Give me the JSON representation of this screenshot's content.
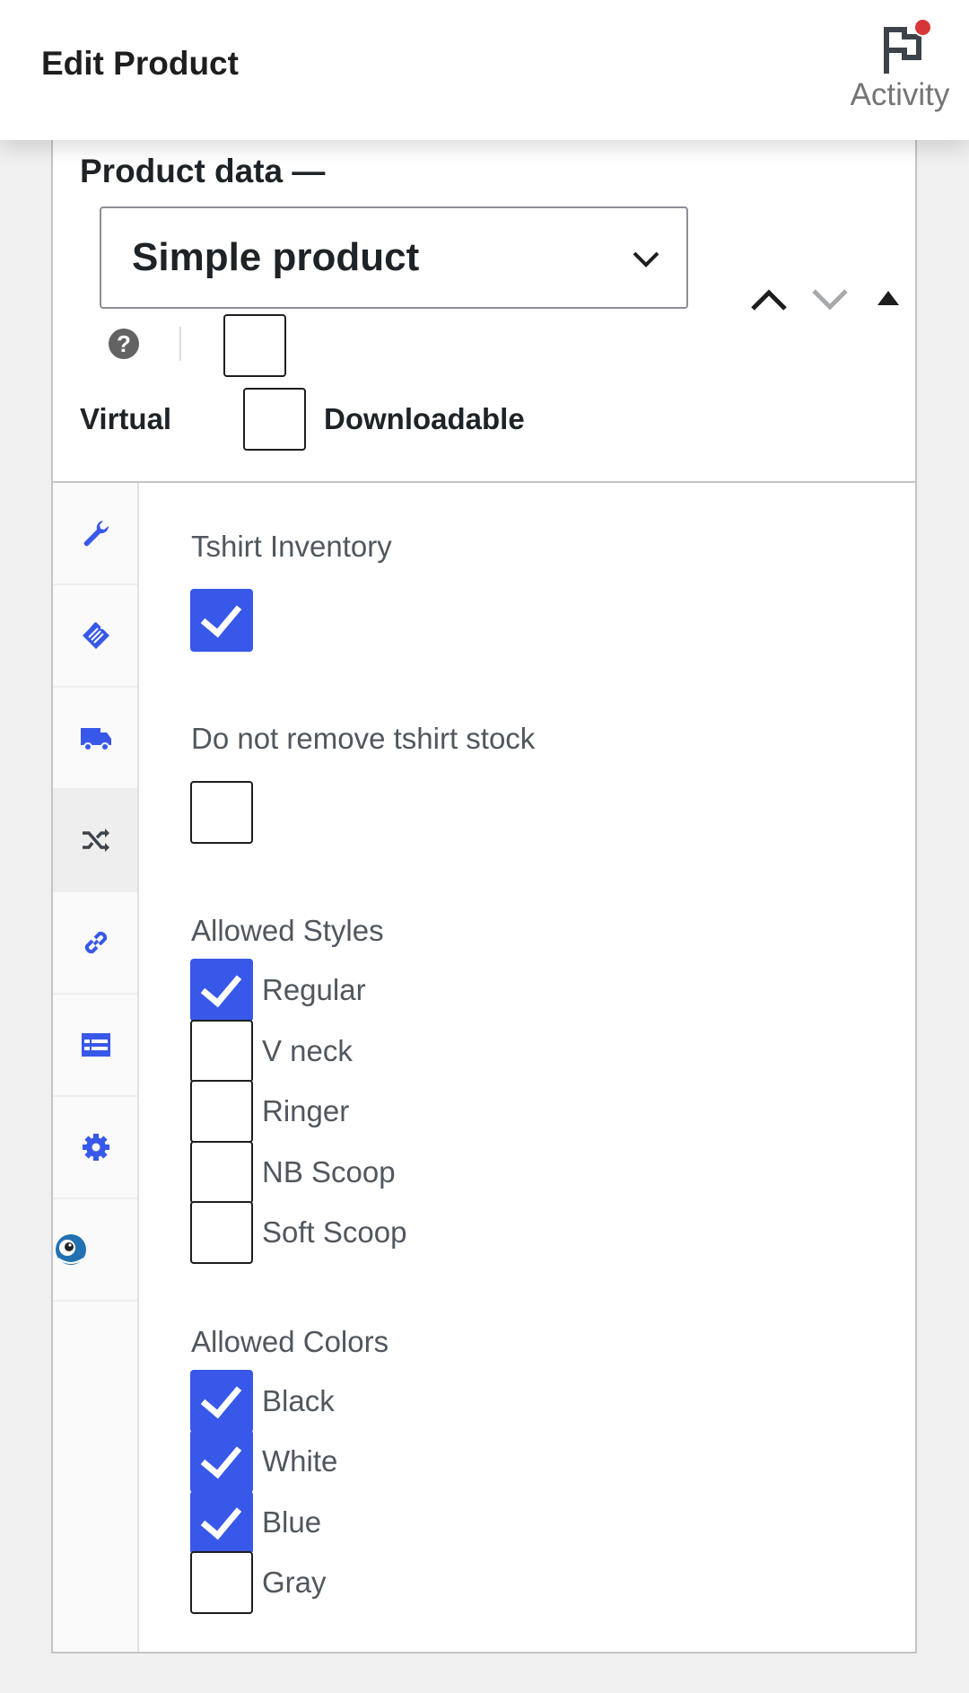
{
  "header": {
    "title": "Edit Product",
    "activity_label": "Activity"
  },
  "product_data": {
    "heading": "Product data —",
    "type_select": {
      "value": "Simple product"
    },
    "help_icon": "?",
    "virtual_label": "Virtual",
    "downloadable_label": "Downloadable",
    "virtual_checked": false,
    "downloadable_checked": false
  },
  "tabs": [
    {
      "icon": "wrench-icon",
      "active": false
    },
    {
      "icon": "tag-icon",
      "active": false
    },
    {
      "icon": "truck-icon",
      "active": false
    },
    {
      "icon": "shuffle-icon",
      "active": true
    },
    {
      "icon": "link-icon",
      "active": false
    },
    {
      "icon": "list-table-icon",
      "active": false
    },
    {
      "icon": "gear-icon",
      "active": false
    },
    {
      "icon": "plugin-logo-icon",
      "active": false
    }
  ],
  "fields": {
    "tshirt_inventory": {
      "label": "Tshirt Inventory",
      "checked": true
    },
    "do_not_remove": {
      "label": "Do not remove tshirt stock",
      "checked": false
    },
    "allowed_styles": {
      "label": "Allowed Styles",
      "options": [
        {
          "label": "Regular",
          "checked": true
        },
        {
          "label": "V neck",
          "checked": false
        },
        {
          "label": "Ringer",
          "checked": false
        },
        {
          "label": "NB Scoop",
          "checked": false
        },
        {
          "label": "Soft Scoop",
          "checked": false
        }
      ]
    },
    "allowed_colors": {
      "label": "Allowed Colors",
      "options": [
        {
          "label": "Black",
          "checked": true
        },
        {
          "label": "White",
          "checked": true
        },
        {
          "label": "Blue",
          "checked": true
        },
        {
          "label": "Gray",
          "checked": false
        }
      ]
    }
  },
  "colors": {
    "accent": "#3858e9",
    "notification": "#d63638"
  }
}
